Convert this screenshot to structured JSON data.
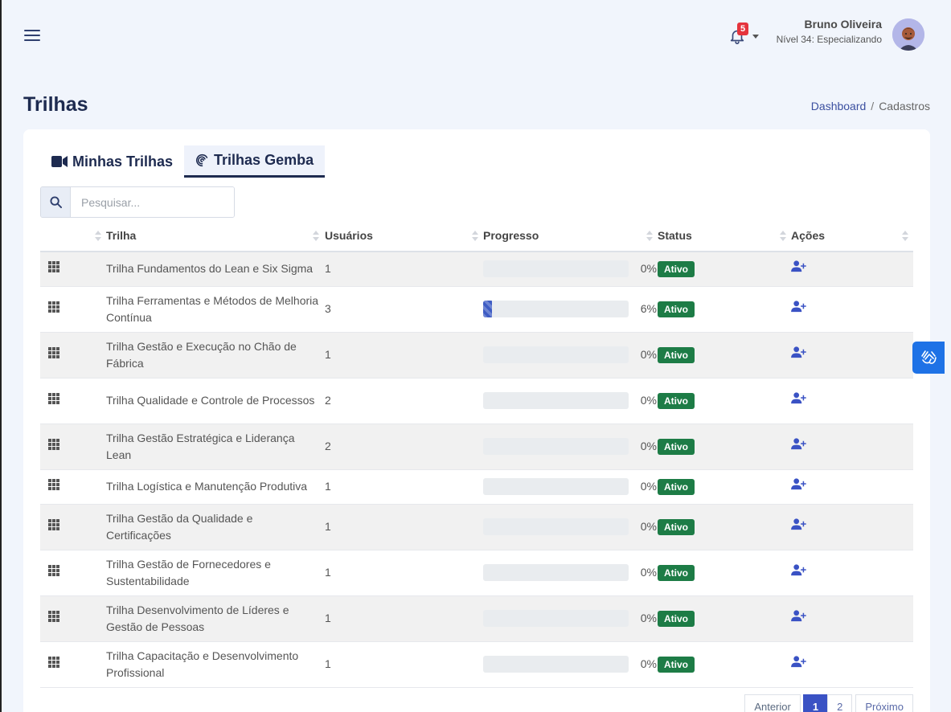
{
  "header": {
    "notifications_count": "5",
    "user_name": "Bruno Oliveira",
    "user_level": "Nível 34: Especializando"
  },
  "page": {
    "title": "Trilhas",
    "breadcrumb": {
      "link": "Dashboard",
      "separator": "/",
      "current": "Cadastros"
    }
  },
  "tabs": [
    {
      "label": "Minhas Trilhas",
      "icon": "video-camera-icon",
      "active": false
    },
    {
      "label": "Trilhas Gemba",
      "icon": "gemba-swirl-icon",
      "active": true
    }
  ],
  "search": {
    "placeholder": "Pesquisar..."
  },
  "table": {
    "headers": [
      "",
      "Trilha",
      "Usuários",
      "Progresso",
      "Status",
      "Ações"
    ],
    "rows": [
      {
        "name": "Trilha Fundamentos do Lean e Six Sigma",
        "users": "1",
        "progress": 0,
        "progress_label": "0%",
        "status": "Ativo"
      },
      {
        "name": "Trilha Ferramentas e Métodos de Melhoria Contínua",
        "users": "3",
        "progress": 6,
        "progress_label": "6%",
        "status": "Ativo"
      },
      {
        "name": "Trilha Gestão e Execução no Chão de Fábrica",
        "users": "1",
        "progress": 0,
        "progress_label": "0%",
        "status": "Ativo"
      },
      {
        "name": "Trilha Qualidade e Controle de Processos",
        "users": "2",
        "progress": 0,
        "progress_label": "0%",
        "status": "Ativo"
      },
      {
        "name": "Trilha Gestão Estratégica e Liderança Lean",
        "users": "2",
        "progress": 0,
        "progress_label": "0%",
        "status": "Ativo"
      },
      {
        "name": "Trilha Logística e Manutenção Produtiva",
        "users": "1",
        "progress": 0,
        "progress_label": "0%",
        "status": "Ativo"
      },
      {
        "name": "Trilha Gestão da Qualidade e Certificações",
        "users": "1",
        "progress": 0,
        "progress_label": "0%",
        "status": "Ativo"
      },
      {
        "name": "Trilha Gestão de Fornecedores e Sustentabilidade",
        "users": "1",
        "progress": 0,
        "progress_label": "0%",
        "status": "Ativo"
      },
      {
        "name": "Trilha Desenvolvimento de Líderes e Gestão de Pessoas",
        "users": "1",
        "progress": 0,
        "progress_label": "0%",
        "status": "Ativo"
      },
      {
        "name": "Trilha Capacitação e Desenvolvimento Profissional",
        "users": "1",
        "progress": 0,
        "progress_label": "0%",
        "status": "Ativo"
      }
    ]
  },
  "pagination": {
    "prev": "Anterior",
    "pages": [
      "1",
      "2"
    ],
    "active_page": "1",
    "next": "Próximo"
  },
  "colors": {
    "primary": "#1e2b50",
    "accent": "#3a52c4",
    "status_active": "#1d7c46",
    "badge_red": "#e5343d",
    "a11y_blue": "#1e72e6"
  }
}
